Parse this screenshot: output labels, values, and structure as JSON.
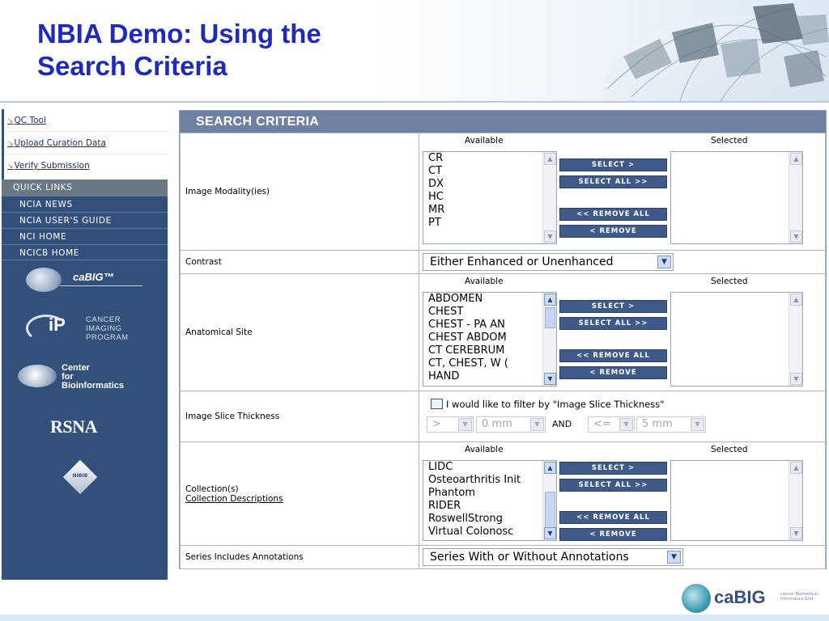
{
  "slide": {
    "title_line1": "NBIA Demo:  Using the",
    "title_line2": "Search Criteria"
  },
  "nav": {
    "top_links": [
      {
        "label": "QC Tool"
      },
      {
        "label": "Upload Curation Data"
      },
      {
        "label": "Verify Submission"
      }
    ],
    "quick_links_header": "QUICK LINKS",
    "quick_links": [
      {
        "label": "NCIA NEWS"
      },
      {
        "label": "NCIA USER'S GUIDE"
      },
      {
        "label": "NCI HOME"
      },
      {
        "label": "NCICB HOME"
      }
    ],
    "logos": {
      "cabig": "caBIG™",
      "cip_line1": "CANCER",
      "cip_line2": "IMAGING",
      "cip_line3": "PROGRAM",
      "cbiit_line1": "Center",
      "cbiit_line2": "for",
      "cbiit_line3": "Bioinformatics",
      "rsna": "RSNA",
      "nbib": "NIBIB"
    }
  },
  "search": {
    "header": "SEARCH CRITERIA",
    "available_label": "Available",
    "selected_label": "Selected",
    "buttons": {
      "select": "SELECT >",
      "select_all": "SELECT ALL >>",
      "remove_all": "<< REMOVE ALL",
      "remove": "< REMOVE"
    },
    "modality": {
      "label": "Image Modality(ies)",
      "available": [
        "CR",
        "CT",
        "DX",
        "HC",
        "MR",
        "PT"
      ]
    },
    "contrast": {
      "label": "Contrast",
      "value": "Either Enhanced or Unenhanced"
    },
    "anatomical": {
      "label": "Anatomical Site",
      "available": [
        "ABDOMEN",
        "CHEST",
        "CHEST - PA AN",
        "CHEST ABDOM",
        "CT CEREBRUM",
        "CT, CHEST, W (",
        "HAND"
      ]
    },
    "slice_thickness": {
      "label": "Image Slice Thickness",
      "checkbox_label": "I would like to filter by \"Image Slice Thickness\"",
      "op1": ">",
      "val1": "0 mm",
      "and_label": "AND",
      "op2": "<=",
      "val2": "5 mm"
    },
    "collection": {
      "label": "Collection(s)",
      "desc_link": "Collection Descriptions",
      "available": [
        "LIDC",
        "Osteoarthritis Init",
        "Phantom",
        "RIDER",
        "RoswellStrong",
        "Virtual Colonosc"
      ]
    },
    "annotations": {
      "label": "Series Includes Annotations",
      "value": "Series With or Without Annotations"
    }
  },
  "footer": {
    "logo_text": "caBIG",
    "logo_small": "cancer Biomedical Informatics Grid"
  },
  "colors": {
    "title": "#1f2bb8",
    "nav_bg": "#33507a",
    "panel_header": "#6f81a3",
    "button": "#3f5a89"
  }
}
